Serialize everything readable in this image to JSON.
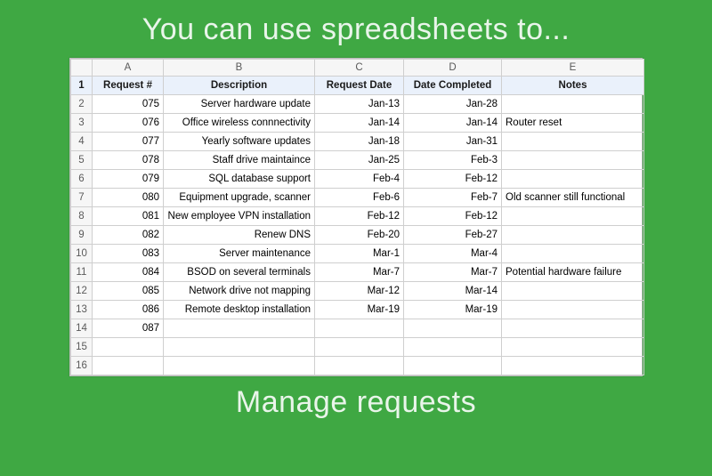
{
  "top_title": "You can use spreadsheets to...",
  "bottom_title": "Manage requests",
  "columns": {
    "A": "A",
    "B": "B",
    "C": "C",
    "D": "D",
    "E": "E"
  },
  "headers": {
    "request_no": "Request #",
    "description": "Description",
    "request_date": "Request Date",
    "date_completed": "Date Completed",
    "notes": "Notes"
  },
  "rows": [
    {
      "n": "2",
      "request_no": "075",
      "description": "Server hardware update",
      "request_date": "Jan-13",
      "date_completed": "Jan-28",
      "notes": ""
    },
    {
      "n": "3",
      "request_no": "076",
      "description": "Office wireless connnectivity",
      "request_date": "Jan-14",
      "date_completed": "Jan-14",
      "notes": "Router reset"
    },
    {
      "n": "4",
      "request_no": "077",
      "description": "Yearly software updates",
      "request_date": "Jan-18",
      "date_completed": "Jan-31",
      "notes": ""
    },
    {
      "n": "5",
      "request_no": "078",
      "description": "Staff drive maintaince",
      "request_date": "Jan-25",
      "date_completed": "Feb-3",
      "notes": ""
    },
    {
      "n": "6",
      "request_no": "079",
      "description": "SQL database support",
      "request_date": "Feb-4",
      "date_completed": "Feb-12",
      "notes": ""
    },
    {
      "n": "7",
      "request_no": "080",
      "description": "Equipment upgrade, scanner",
      "request_date": "Feb-6",
      "date_completed": "Feb-7",
      "notes": "Old scanner still functional"
    },
    {
      "n": "8",
      "request_no": "081",
      "description": "New employee VPN installation",
      "request_date": "Feb-12",
      "date_completed": "Feb-12",
      "notes": ""
    },
    {
      "n": "9",
      "request_no": "082",
      "description": "Renew DNS",
      "request_date": "Feb-20",
      "date_completed": "Feb-27",
      "notes": ""
    },
    {
      "n": "10",
      "request_no": "083",
      "description": "Server maintenance",
      "request_date": "Mar-1",
      "date_completed": "Mar-4",
      "notes": ""
    },
    {
      "n": "11",
      "request_no": "084",
      "description": "BSOD on several terminals",
      "request_date": "Mar-7",
      "date_completed": "Mar-7",
      "notes": "Potential hardware failure"
    },
    {
      "n": "12",
      "request_no": "085",
      "description": "Network drive not mapping",
      "request_date": "Mar-12",
      "date_completed": "Mar-14",
      "notes": ""
    },
    {
      "n": "13",
      "request_no": "086",
      "description": "Remote desktop installation",
      "request_date": "Mar-19",
      "date_completed": "Mar-19",
      "notes": ""
    },
    {
      "n": "14",
      "request_no": "087",
      "description": "",
      "request_date": "",
      "date_completed": "",
      "notes": ""
    },
    {
      "n": "15",
      "request_no": "",
      "description": "",
      "request_date": "",
      "date_completed": "",
      "notes": ""
    },
    {
      "n": "16",
      "request_no": "",
      "description": "",
      "request_date": "",
      "date_completed": "",
      "notes": ""
    }
  ],
  "header_rownum": "1"
}
